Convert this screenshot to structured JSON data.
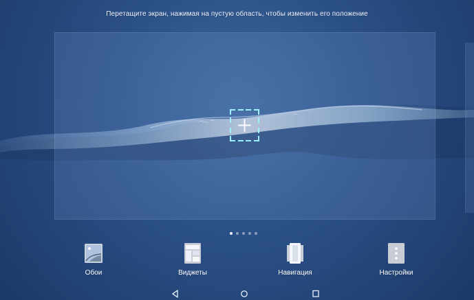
{
  "instruction": {
    "text": "Перетащите экран, нажимая на пустую область, чтобы изменить его положение"
  },
  "pager": {
    "total": 5,
    "active_index": 0
  },
  "toolbar": {
    "wallpaper_label": "Обои",
    "widgets_label": "Виджеты",
    "navigation_label": "Навигация",
    "settings_label": "Настройки"
  },
  "icons": {
    "add": "plus-icon",
    "wallpaper": "wallpaper-icon",
    "widgets": "widgets-icon",
    "navigation": "navigation-icon",
    "settings": "settings-icon",
    "back": "back-icon",
    "home": "home-icon",
    "recent": "recent-apps-icon"
  },
  "colors": {
    "accent": "#9ff1ff",
    "background": "#2a4f86"
  }
}
